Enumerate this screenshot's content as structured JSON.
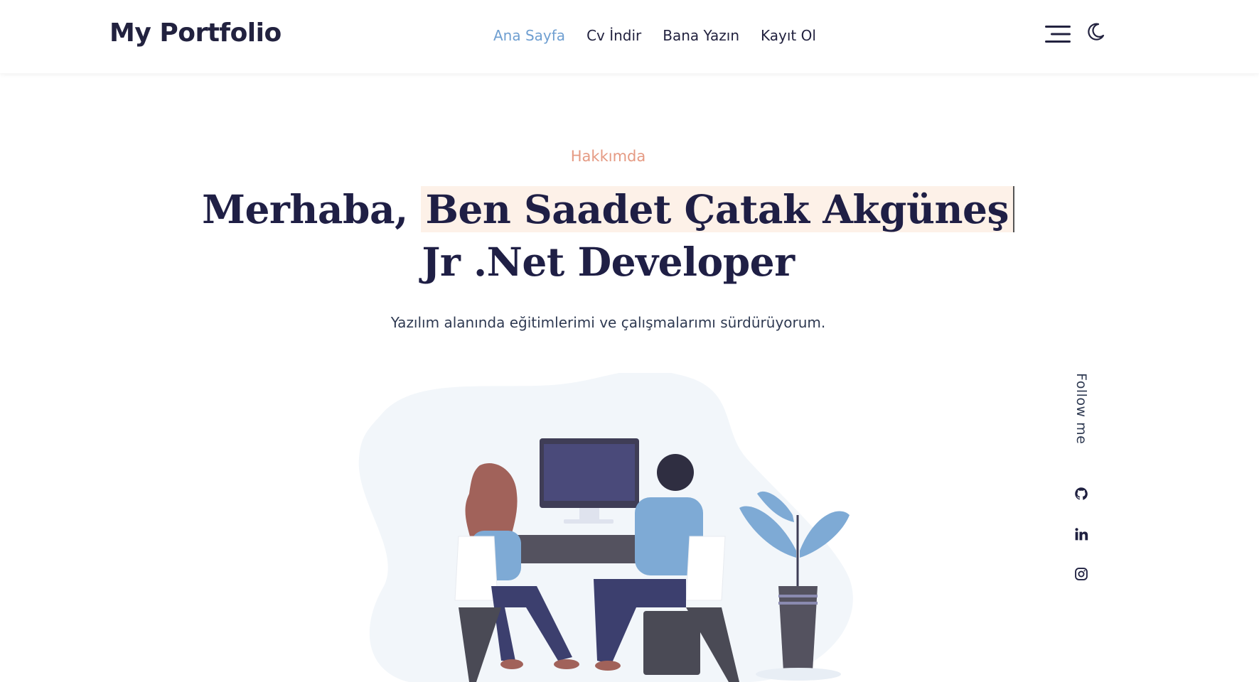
{
  "header": {
    "brand": "My Portfolio",
    "nav": [
      {
        "label": "Ana Sayfa",
        "active": true
      },
      {
        "label": "Cv İndir",
        "active": false
      },
      {
        "label": "Bana Yazın",
        "active": false
      },
      {
        "label": "Kayıt Ol",
        "active": false
      }
    ],
    "icons": [
      "menu-icon",
      "moon-icon"
    ]
  },
  "hero": {
    "eyebrow": "Hakkımda",
    "greeting": "Merhaba,",
    "name": "Ben Saadet Çatak Akgüneş",
    "role": "Jr .Net Developer",
    "subtitle": "Yazılım alanında eğitimlerimi ve çalışmalarımı sürdürüyorum."
  },
  "social": {
    "follow_label": "Follow me",
    "icons": [
      "github-icon",
      "linkedin-icon",
      "instagram-icon"
    ]
  },
  "colors": {
    "accent": "#6f9fd1",
    "eyebrow": "#e59a83",
    "heading": "#1f1f45",
    "highlight": "#fdf1e8"
  }
}
